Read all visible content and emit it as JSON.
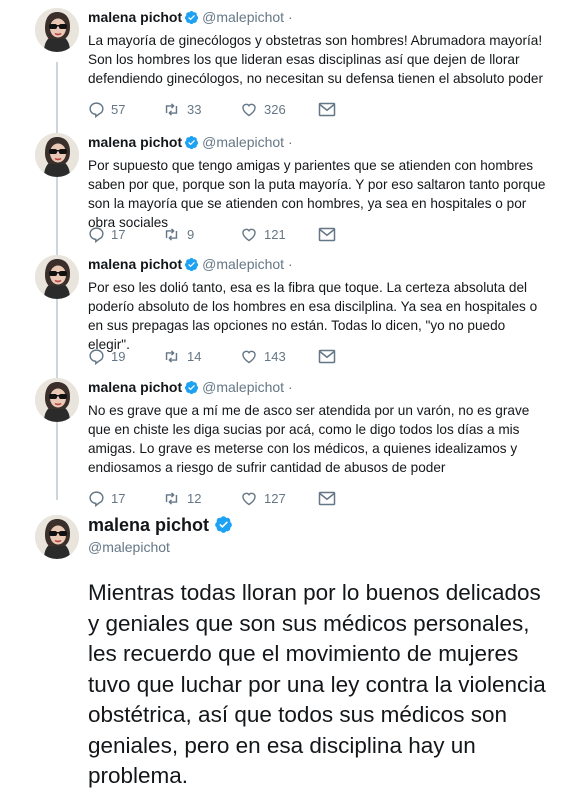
{
  "colors": {
    "accent": "#1da1f2",
    "muted": "#657786",
    "text": "#14171a",
    "thread_line": "#ccd6dd"
  },
  "tweets": [
    {
      "name": "malena pichot",
      "handle": "@malepichot",
      "separator": "·",
      "text": "La mayoría de ginecólogos y obstetras son hombres! Abrumadora mayoría! Son los hombres los que lideran esas disciplinas así que dejen de llorar defendiendo ginecólogos, no necesitan su defensa tienen el absoluto poder",
      "replies": "57",
      "retweets": "33",
      "likes": "326"
    },
    {
      "name": "malena pichot",
      "handle": "@malepichot",
      "separator": "·",
      "text": "Por supuesto que tengo amigas y parientes que se atienden con hombres saben por que, porque son la puta mayoría. Y por eso saltaron tanto porque son la mayoría que se atienden con hombres, ya sea en hospitales o por obra sociales",
      "replies": "17",
      "retweets": "9",
      "likes": "121"
    },
    {
      "name": "malena pichot",
      "handle": "@malepichot",
      "separator": "·",
      "text": "Por eso les dolió tanto, esa es la fibra que toque. La certeza absoluta del poderío absoluto de los hombres en esa discilplina. Ya sea en hospitales o en sus prepagas las opciones no están. Todas lo dicen, \"yo no puedo elegir\".",
      "replies": "19",
      "retweets": "14",
      "likes": "143"
    },
    {
      "name": "malena pichot",
      "handle": "@malepichot",
      "separator": "·",
      "text": "No es grave que a mí me de asco ser atendida por un varón, no es grave que en chiste les diga sucias por acá, como le digo todos los días a mis amigas. Lo grave es meterse con los médicos, a quienes idealizamos y endiosamos a riesgo de sufrir cantidad de abusos de poder",
      "replies": "17",
      "retweets": "12",
      "likes": "127"
    }
  ],
  "main_tweet": {
    "name": "malena pichot",
    "handle": "@malepichot",
    "text": "Mientras todas lloran por lo buenos delicados y geniales que son sus médicos personales, les recuerdo que el movimiento de mujeres tuvo que luchar por una ley contra la violencia obstétrica, así que todos sus médicos son geniales, pero en esa disciplina hay un problema."
  }
}
